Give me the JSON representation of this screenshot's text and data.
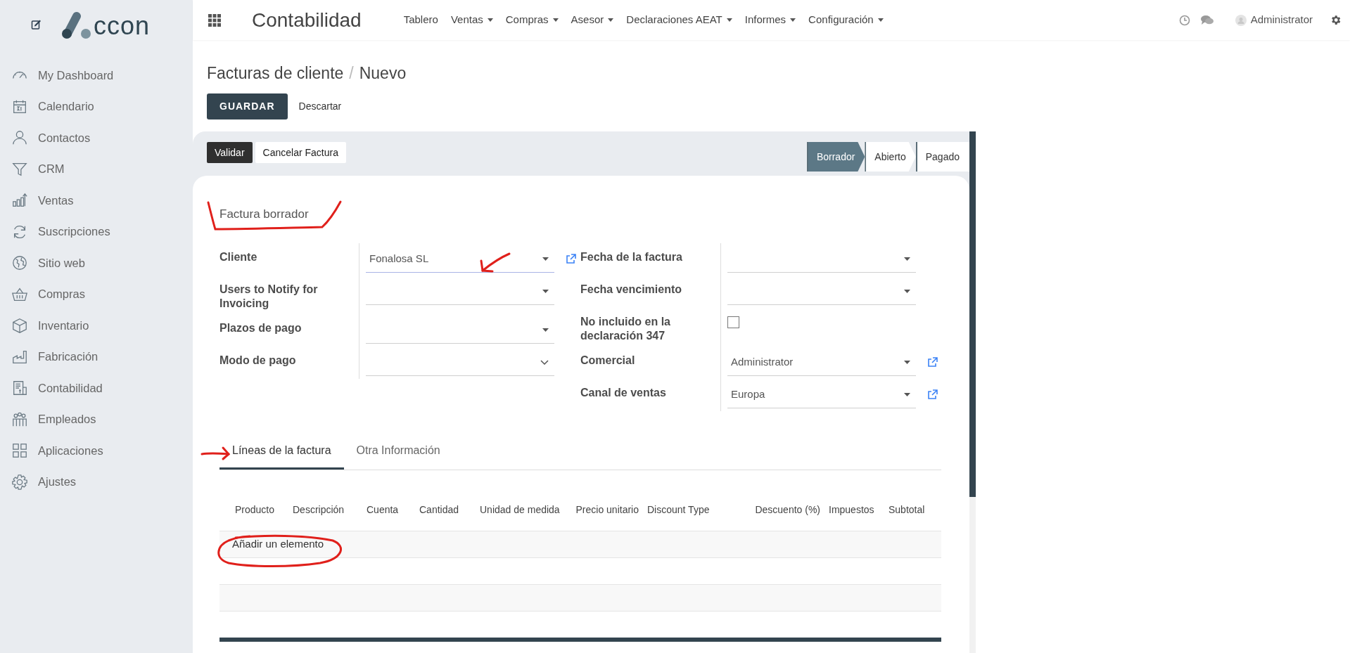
{
  "sidebar": {
    "logo_text": "ccon",
    "items": [
      {
        "label": "My Dashboard"
      },
      {
        "label": "Calendario"
      },
      {
        "label": "Contactos"
      },
      {
        "label": "CRM"
      },
      {
        "label": "Ventas"
      },
      {
        "label": "Suscripciones"
      },
      {
        "label": "Sitio web"
      },
      {
        "label": "Compras"
      },
      {
        "label": "Inventario"
      },
      {
        "label": "Fabricación"
      },
      {
        "label": "Contabilidad"
      },
      {
        "label": "Empleados"
      },
      {
        "label": "Aplicaciones"
      },
      {
        "label": "Ajustes"
      }
    ]
  },
  "topbar": {
    "app_title": "Contabilidad",
    "menu": [
      {
        "label": "Tablero",
        "dropdown": false
      },
      {
        "label": "Ventas",
        "dropdown": true
      },
      {
        "label": "Compras",
        "dropdown": true
      },
      {
        "label": "Asesor",
        "dropdown": true
      },
      {
        "label": "Declaraciones AEAT",
        "dropdown": true
      },
      {
        "label": "Informes",
        "dropdown": true
      },
      {
        "label": "Configuración",
        "dropdown": true
      }
    ],
    "user": "Administrator"
  },
  "breadcrumb": {
    "items": [
      "Facturas de cliente",
      "Nuevo"
    ],
    "separator": "/"
  },
  "control_buttons": {
    "save": "GUARDAR",
    "discard": "Descartar"
  },
  "actions": [
    {
      "label": "Validar",
      "primary": true
    },
    {
      "label": "Cancelar Factura",
      "primary": false
    }
  ],
  "status_steps": [
    {
      "label": "Borrador",
      "selected": true
    },
    {
      "label": "Abierto",
      "selected": false
    },
    {
      "label": "Pagado",
      "selected": false
    }
  ],
  "sheet": {
    "title": "Factura borrador",
    "left_fields": [
      {
        "label": "Cliente",
        "kind": "dropdown",
        "value": "Fonalosa SL",
        "focused": true,
        "link": true
      },
      {
        "label": "Users to Notify for Invoicing",
        "kind": "dropdown",
        "focused": false,
        "link": false
      },
      {
        "label": "Plazos de pago",
        "kind": "dropdown",
        "focused": false,
        "link": false
      },
      {
        "label": "Modo de pago",
        "kind": "select",
        "focused": false,
        "link": false
      }
    ],
    "right_fields": [
      {
        "label": "Fecha de la factura",
        "kind": "dropdown",
        "focused": false,
        "link": false
      },
      {
        "label": "Fecha vencimiento",
        "kind": "dropdown",
        "focused": false,
        "link": false
      },
      {
        "label": "No incluido en la declaración 347",
        "kind": "checkbox",
        "checked": false
      },
      {
        "label": "Comercial",
        "kind": "dropdown",
        "value": "Administrator",
        "focused": false,
        "link": true
      },
      {
        "label": "Canal de ventas",
        "kind": "dropdown",
        "value": "Europa",
        "focused": false,
        "link": true
      }
    ],
    "tabs": [
      {
        "label": "Líneas de la factura",
        "selected": true
      },
      {
        "label": "Otra Información",
        "selected": false
      }
    ],
    "table": {
      "columns": [
        {
          "label": "Producto",
          "kind": "text"
        },
        {
          "label": "Descripción",
          "kind": "text"
        },
        {
          "label": "Cuenta",
          "kind": "text"
        },
        {
          "label": "Cantidad",
          "kind": "text"
        },
        {
          "label": "Unidad de medida",
          "kind": "text"
        },
        {
          "label": "Precio unitario",
          "kind": "number"
        },
        {
          "label": "Discount Type",
          "kind": "text"
        },
        {
          "label": "Descuento (%)",
          "kind": "number"
        },
        {
          "label": "Impuestos",
          "kind": "text"
        },
        {
          "label": "Subtotal",
          "kind": "text"
        }
      ],
      "add_line": "Añadir un elemento"
    }
  }
}
